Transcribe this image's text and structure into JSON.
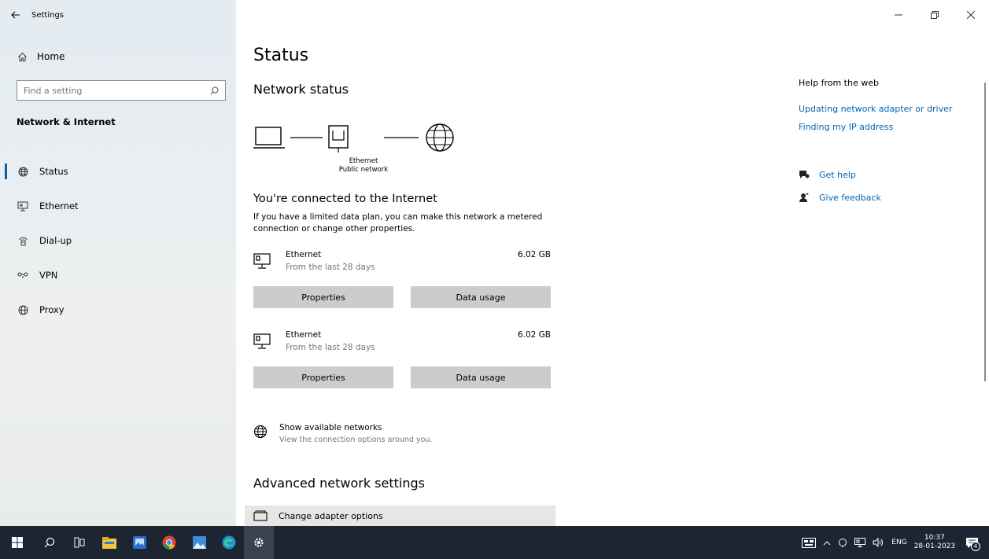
{
  "window": {
    "title": "Settings"
  },
  "sidebar": {
    "home_label": "Home",
    "search_placeholder": "Find a setting",
    "section_title": "Network & Internet",
    "items": [
      {
        "label": "Status",
        "icon": "globe-icon",
        "active": true
      },
      {
        "label": "Ethernet",
        "icon": "ethernet-icon",
        "active": false
      },
      {
        "label": "Dial-up",
        "icon": "dial-up-icon",
        "active": false
      },
      {
        "label": "VPN",
        "icon": "vpn-icon",
        "active": false
      },
      {
        "label": "Proxy",
        "icon": "proxy-globe-icon",
        "active": false
      }
    ]
  },
  "main": {
    "title": "Status",
    "network_status_heading": "Network status",
    "diagram": {
      "adapter_name": "Ethernet",
      "network_type": "Public network"
    },
    "connected_heading": "You're connected to the Internet",
    "description": "If you have a limited data plan, you can make this network a metered connection or change other properties.",
    "adapters": [
      {
        "name": "Ethernet",
        "subtitle": "From the last 28 days",
        "usage": "6.02 GB",
        "properties_label": "Properties",
        "data_usage_label": "Data usage"
      },
      {
        "name": "Ethernet",
        "subtitle": "From the last 28 days",
        "usage": "6.02 GB",
        "properties_label": "Properties",
        "data_usage_label": "Data usage"
      }
    ],
    "show_networks": {
      "title": "Show available networks",
      "subtitle": "View the connection options around you."
    },
    "advanced_heading": "Advanced network settings",
    "change_adapter_label": "Change adapter options"
  },
  "right_panel": {
    "help_title": "Help from the web",
    "links": [
      "Updating network adapter or driver",
      "Finding my IP address"
    ],
    "get_help": "Get help",
    "give_feedback": "Give feedback"
  },
  "taskbar": {
    "language": "ENG",
    "time": "10:37",
    "date": "28-01-2023",
    "notification_count": "4"
  },
  "colors": {
    "accent": "#0063b1",
    "taskbar": "#1d2533",
    "button": "#cccccc"
  }
}
